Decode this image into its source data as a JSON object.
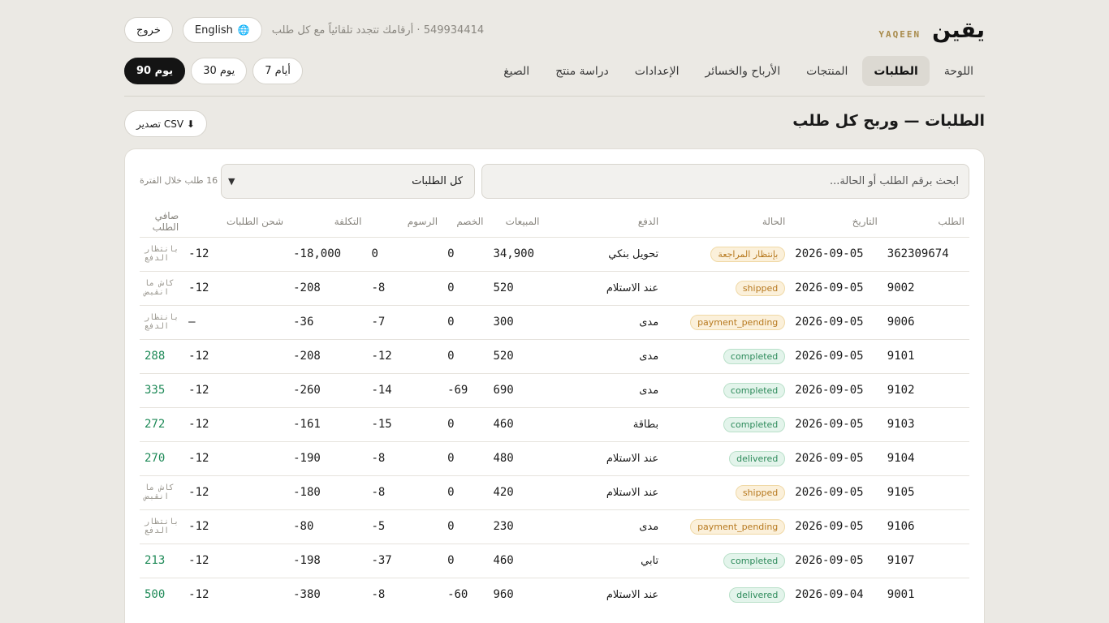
{
  "brand": {
    "ar": "يقين",
    "en": "YAQEEN"
  },
  "header": {
    "logout": "خروج",
    "language": "English",
    "tagline": "549934414 · أرقامك تتجدد تلقائياً مع كل طلب"
  },
  "nav": [
    {
      "label": "اللوحة"
    },
    {
      "label": "الطلبات",
      "active": true
    },
    {
      "label": "المنتجات"
    },
    {
      "label": "الأرباح والخسائر"
    },
    {
      "label": "الإعدادات"
    },
    {
      "label": "دراسة منتج"
    },
    {
      "label": "الصيغ"
    }
  ],
  "ranges": [
    {
      "label": "7 أيام"
    },
    {
      "label": "30 يوم"
    },
    {
      "label": "90 يوم",
      "selected": true
    }
  ],
  "page": {
    "title": "الطلبات — وربح كل طلب",
    "export": "تصدير CSV ⬇"
  },
  "toolbar": {
    "search_placeholder": "ابحث برقم الطلب أو الحالة...",
    "filter_value": "كل الطلبات",
    "count": "16 طلب خلال الفترة"
  },
  "table": {
    "headers": [
      "الطلب",
      "التاريخ",
      "الحالة",
      "الدفع",
      "المبيعات",
      "الخصم",
      "الرسوم",
      "التكلفة",
      "شحن الطلبات",
      "صافي الطلب"
    ],
    "rows": [
      {
        "id": "362309674",
        "date": "2026-09-05",
        "status": "بإنتظار المراجعة",
        "status_kind": "warn",
        "pay": "تحويل بنكي",
        "sales": "34,900",
        "discount": "0",
        "fees": "0",
        "cost": "-18,000",
        "shipping": "-12",
        "net": "بانتظار الدفع",
        "net_kind": "mute"
      },
      {
        "id": "9002",
        "date": "2026-09-05",
        "status": "shipped",
        "status_kind": "warn",
        "pay": "عند الاستلام",
        "sales": "520",
        "discount": "0",
        "fees": "-8",
        "cost": "-208",
        "shipping": "-12",
        "net": "كاش ما انقبض",
        "net_kind": "mute"
      },
      {
        "id": "9006",
        "date": "2026-09-05",
        "status": "payment_pending",
        "status_kind": "warn",
        "pay": "مدى",
        "sales": "300",
        "discount": "0",
        "fees": "-7",
        "cost": "-36",
        "shipping": "—",
        "net": "بانتظار الدفع",
        "net_kind": "mute"
      },
      {
        "id": "9101",
        "date": "2026-09-05",
        "status": "completed",
        "status_kind": "ok",
        "pay": "مدى",
        "sales": "520",
        "discount": "0",
        "fees": "-12",
        "cost": "-208",
        "shipping": "-12",
        "net": "288",
        "net_kind": "pos"
      },
      {
        "id": "9102",
        "date": "2026-09-05",
        "status": "completed",
        "status_kind": "ok",
        "pay": "مدى",
        "sales": "690",
        "discount": "-69",
        "fees": "-14",
        "cost": "-260",
        "shipping": "-12",
        "net": "335",
        "net_kind": "pos"
      },
      {
        "id": "9103",
        "date": "2026-09-05",
        "status": "completed",
        "status_kind": "ok",
        "pay": "بطاقة",
        "sales": "460",
        "discount": "0",
        "fees": "-15",
        "cost": "-161",
        "shipping": "-12",
        "net": "272",
        "net_kind": "pos"
      },
      {
        "id": "9104",
        "date": "2026-09-05",
        "status": "delivered",
        "status_kind": "ok",
        "pay": "عند الاستلام",
        "sales": "480",
        "discount": "0",
        "fees": "-8",
        "cost": "-190",
        "shipping": "-12",
        "net": "270",
        "net_kind": "pos"
      },
      {
        "id": "9105",
        "date": "2026-09-05",
        "status": "shipped",
        "status_kind": "warn",
        "pay": "عند الاستلام",
        "sales": "420",
        "discount": "0",
        "fees": "-8",
        "cost": "-180",
        "shipping": "-12",
        "net": "كاش ما انقبض",
        "net_kind": "mute"
      },
      {
        "id": "9106",
        "date": "2026-09-05",
        "status": "payment_pending",
        "status_kind": "warn",
        "pay": "مدى",
        "sales": "230",
        "discount": "0",
        "fees": "-5",
        "cost": "-80",
        "shipping": "-12",
        "net": "بانتظار الدفع",
        "net_kind": "mute"
      },
      {
        "id": "9107",
        "date": "2026-09-05",
        "status": "completed",
        "status_kind": "ok",
        "pay": "تابي",
        "sales": "460",
        "discount": "0",
        "fees": "-37",
        "cost": "-198",
        "shipping": "-12",
        "net": "213",
        "net_kind": "pos"
      },
      {
        "id": "9001",
        "date": "2026-09-04",
        "status": "delivered",
        "status_kind": "ok",
        "pay": "عند الاستلام",
        "sales": "960",
        "discount": "-60",
        "fees": "-8",
        "cost": "-380",
        "shipping": "-12",
        "net": "500",
        "net_kind": "pos"
      }
    ]
  },
  "colors": {
    "accent": "#141414",
    "positive": "#1f8a58",
    "warn": "#b7791f",
    "brand_gold": "#a88a4a"
  }
}
